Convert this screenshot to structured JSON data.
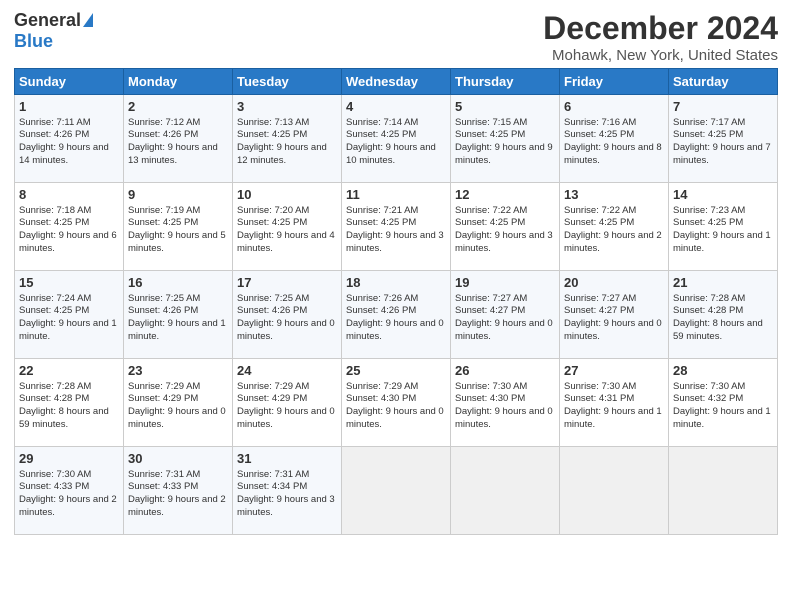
{
  "logo": {
    "general": "General",
    "blue": "Blue"
  },
  "title": "December 2024",
  "subtitle": "Mohawk, New York, United States",
  "weekdays": [
    "Sunday",
    "Monday",
    "Tuesday",
    "Wednesday",
    "Thursday",
    "Friday",
    "Saturday"
  ],
  "weeks": [
    [
      {
        "day": "1",
        "sunrise": "7:11 AM",
        "sunset": "4:26 PM",
        "daylight": "9 hours and 14 minutes."
      },
      {
        "day": "2",
        "sunrise": "7:12 AM",
        "sunset": "4:26 PM",
        "daylight": "9 hours and 13 minutes."
      },
      {
        "day": "3",
        "sunrise": "7:13 AM",
        "sunset": "4:25 PM",
        "daylight": "9 hours and 12 minutes."
      },
      {
        "day": "4",
        "sunrise": "7:14 AM",
        "sunset": "4:25 PM",
        "daylight": "9 hours and 10 minutes."
      },
      {
        "day": "5",
        "sunrise": "7:15 AM",
        "sunset": "4:25 PM",
        "daylight": "9 hours and 9 minutes."
      },
      {
        "day": "6",
        "sunrise": "7:16 AM",
        "sunset": "4:25 PM",
        "daylight": "9 hours and 8 minutes."
      },
      {
        "day": "7",
        "sunrise": "7:17 AM",
        "sunset": "4:25 PM",
        "daylight": "9 hours and 7 minutes."
      }
    ],
    [
      {
        "day": "8",
        "sunrise": "7:18 AM",
        "sunset": "4:25 PM",
        "daylight": "9 hours and 6 minutes."
      },
      {
        "day": "9",
        "sunrise": "7:19 AM",
        "sunset": "4:25 PM",
        "daylight": "9 hours and 5 minutes."
      },
      {
        "day": "10",
        "sunrise": "7:20 AM",
        "sunset": "4:25 PM",
        "daylight": "9 hours and 4 minutes."
      },
      {
        "day": "11",
        "sunrise": "7:21 AM",
        "sunset": "4:25 PM",
        "daylight": "9 hours and 3 minutes."
      },
      {
        "day": "12",
        "sunrise": "7:22 AM",
        "sunset": "4:25 PM",
        "daylight": "9 hours and 3 minutes."
      },
      {
        "day": "13",
        "sunrise": "7:22 AM",
        "sunset": "4:25 PM",
        "daylight": "9 hours and 2 minutes."
      },
      {
        "day": "14",
        "sunrise": "7:23 AM",
        "sunset": "4:25 PM",
        "daylight": "9 hours and 1 minute."
      }
    ],
    [
      {
        "day": "15",
        "sunrise": "7:24 AM",
        "sunset": "4:25 PM",
        "daylight": "9 hours and 1 minute."
      },
      {
        "day": "16",
        "sunrise": "7:25 AM",
        "sunset": "4:26 PM",
        "daylight": "9 hours and 1 minute."
      },
      {
        "day": "17",
        "sunrise": "7:25 AM",
        "sunset": "4:26 PM",
        "daylight": "9 hours and 0 minutes."
      },
      {
        "day": "18",
        "sunrise": "7:26 AM",
        "sunset": "4:26 PM",
        "daylight": "9 hours and 0 minutes."
      },
      {
        "day": "19",
        "sunrise": "7:27 AM",
        "sunset": "4:27 PM",
        "daylight": "9 hours and 0 minutes."
      },
      {
        "day": "20",
        "sunrise": "7:27 AM",
        "sunset": "4:27 PM",
        "daylight": "9 hours and 0 minutes."
      },
      {
        "day": "21",
        "sunrise": "7:28 AM",
        "sunset": "4:28 PM",
        "daylight": "8 hours and 59 minutes."
      }
    ],
    [
      {
        "day": "22",
        "sunrise": "7:28 AM",
        "sunset": "4:28 PM",
        "daylight": "8 hours and 59 minutes."
      },
      {
        "day": "23",
        "sunrise": "7:29 AM",
        "sunset": "4:29 PM",
        "daylight": "9 hours and 0 minutes."
      },
      {
        "day": "24",
        "sunrise": "7:29 AM",
        "sunset": "4:29 PM",
        "daylight": "9 hours and 0 minutes."
      },
      {
        "day": "25",
        "sunrise": "7:29 AM",
        "sunset": "4:30 PM",
        "daylight": "9 hours and 0 minutes."
      },
      {
        "day": "26",
        "sunrise": "7:30 AM",
        "sunset": "4:30 PM",
        "daylight": "9 hours and 0 minutes."
      },
      {
        "day": "27",
        "sunrise": "7:30 AM",
        "sunset": "4:31 PM",
        "daylight": "9 hours and 1 minute."
      },
      {
        "day": "28",
        "sunrise": "7:30 AM",
        "sunset": "4:32 PM",
        "daylight": "9 hours and 1 minute."
      }
    ],
    [
      {
        "day": "29",
        "sunrise": "7:30 AM",
        "sunset": "4:33 PM",
        "daylight": "9 hours and 2 minutes."
      },
      {
        "day": "30",
        "sunrise": "7:31 AM",
        "sunset": "4:33 PM",
        "daylight": "9 hours and 2 minutes."
      },
      {
        "day": "31",
        "sunrise": "7:31 AM",
        "sunset": "4:34 PM",
        "daylight": "9 hours and 3 minutes."
      },
      null,
      null,
      null,
      null
    ]
  ]
}
